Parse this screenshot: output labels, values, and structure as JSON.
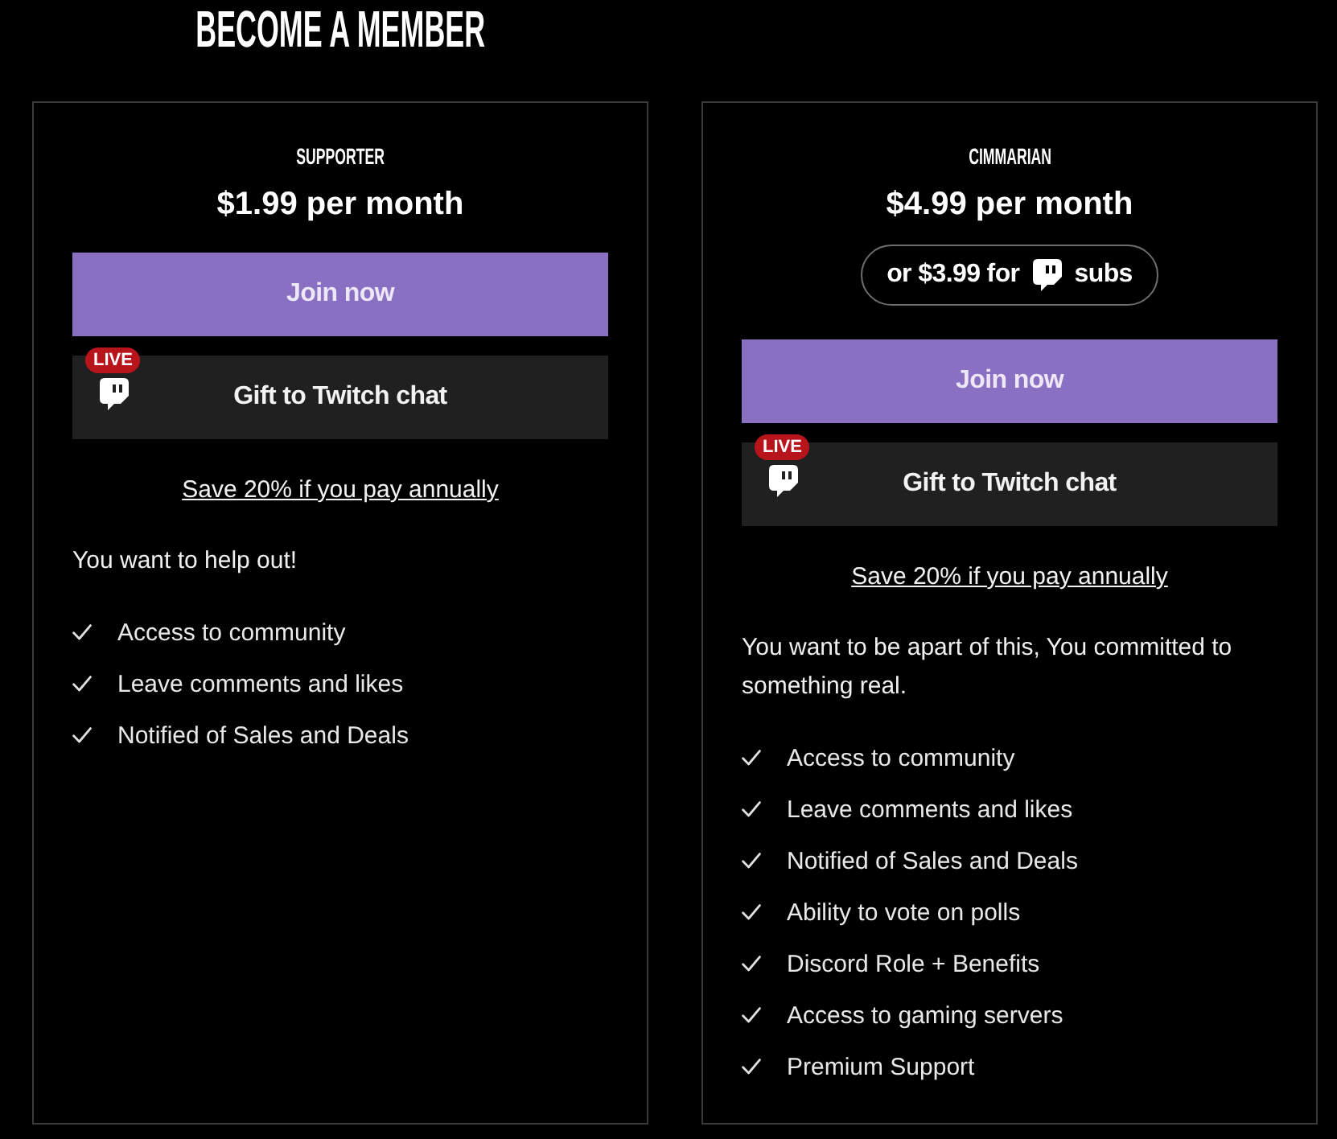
{
  "title": "BECOME A MEMBER",
  "plans": [
    {
      "name": "SUPPORTER",
      "price": "$1.99 per month",
      "join_button": "Join now",
      "gift_button": {
        "label": "Gift to Twitch chat",
        "badge": "LIVE"
      },
      "annual_link": "Save 20% if you pay annually",
      "description": "You want to help out!",
      "features": [
        "Access to community",
        "Leave comments and likes",
        "Notified of Sales and Deals"
      ]
    },
    {
      "name": "CIMMARIAN",
      "price": "$4.99 per month",
      "sub_offer": {
        "prefix": "or $3.99 for",
        "suffix": "subs"
      },
      "join_button": "Join now",
      "gift_button": {
        "label": "Gift to Twitch chat",
        "badge": "LIVE"
      },
      "annual_link": "Save 20% if you pay annually",
      "description": "You want to be apart of this, You committed to something real.",
      "features": [
        "Access to community",
        "Leave comments and likes",
        "Notified of Sales and Deals",
        "Ability to vote on polls",
        "Discord Role + Benefits",
        "Access to gaming servers",
        "Premium Support"
      ]
    }
  ]
}
